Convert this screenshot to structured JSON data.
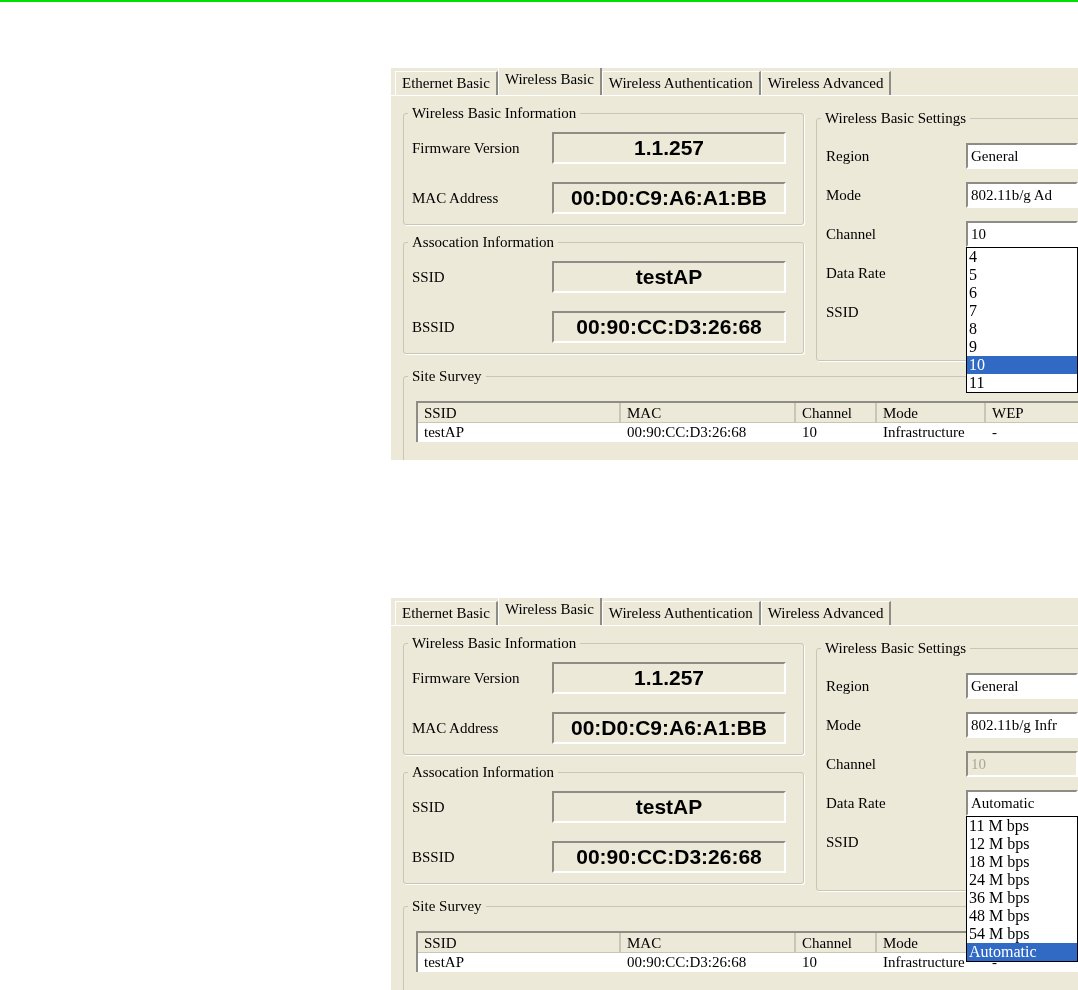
{
  "screenshots": [
    {
      "tabs": [
        {
          "label": "Ethernet Basic",
          "selected": false
        },
        {
          "label": "Wireless Basic",
          "selected": true
        },
        {
          "label": "Wireless Authentication",
          "selected": false
        },
        {
          "label": "Wireless Advanced",
          "selected": false
        }
      ],
      "info_group": {
        "title": "Wireless Basic Information",
        "rows": [
          {
            "label": "Firmware Version",
            "value": "1.1.257"
          },
          {
            "label": "MAC Address",
            "value": "00:D0:C9:A6:A1:BB"
          }
        ]
      },
      "association_group": {
        "title": "Assocation Information",
        "rows": [
          {
            "label": "SSID",
            "value": "testAP"
          },
          {
            "label": "BSSID",
            "value": "00:90:CC:D3:26:68"
          }
        ]
      },
      "settings_group": {
        "title": "Wireless Basic Settings",
        "fields": [
          {
            "label": "Region",
            "value": "General",
            "disabled": false
          },
          {
            "label": "Mode",
            "value": "802.11b/g Ad",
            "disabled": false
          },
          {
            "label": "Channel",
            "value": "10",
            "disabled": false,
            "options": [
              {
                "label": "4",
                "selected": false
              },
              {
                "label": "5",
                "selected": false
              },
              {
                "label": "6",
                "selected": false
              },
              {
                "label": "7",
                "selected": false
              },
              {
                "label": "8",
                "selected": false
              },
              {
                "label": "9",
                "selected": false
              },
              {
                "label": "10",
                "selected": true
              },
              {
                "label": "11",
                "selected": false
              }
            ]
          },
          {
            "label": "Data Rate"
          },
          {
            "label": "SSID"
          }
        ]
      },
      "site_survey": {
        "title": "Site Survey",
        "columns": [
          "SSID",
          "MAC",
          "Channel",
          "Mode",
          "WEP"
        ],
        "rows": [
          [
            "testAP",
            "00:90:CC:D3:26:68",
            "10",
            "Infrastructure",
            "-"
          ]
        ]
      }
    },
    {
      "tabs": [
        {
          "label": "Ethernet Basic",
          "selected": false
        },
        {
          "label": "Wireless Basic",
          "selected": true
        },
        {
          "label": "Wireless Authentication",
          "selected": false
        },
        {
          "label": "Wireless Advanced",
          "selected": false
        }
      ],
      "info_group": {
        "title": "Wireless Basic Information",
        "rows": [
          {
            "label": "Firmware Version",
            "value": "1.1.257"
          },
          {
            "label": "MAC Address",
            "value": "00:D0:C9:A6:A1:BB"
          }
        ]
      },
      "association_group": {
        "title": "Assocation Information",
        "rows": [
          {
            "label": "SSID",
            "value": "testAP"
          },
          {
            "label": "BSSID",
            "value": "00:90:CC:D3:26:68"
          }
        ]
      },
      "settings_group": {
        "title": "Wireless Basic Settings",
        "fields": [
          {
            "label": "Region",
            "value": "General",
            "disabled": false
          },
          {
            "label": "Mode",
            "value": "802.11b/g Infr",
            "disabled": false
          },
          {
            "label": "Channel",
            "value": "10",
            "disabled": true
          },
          {
            "label": "Data Rate",
            "value": "Automatic",
            "disabled": false,
            "options": [
              {
                "label": "11 M bps",
                "selected": false
              },
              {
                "label": "12 M bps",
                "selected": false
              },
              {
                "label": "18 M bps",
                "selected": false
              },
              {
                "label": "24 M bps",
                "selected": false
              },
              {
                "label": "36 M bps",
                "selected": false
              },
              {
                "label": "48 M bps",
                "selected": false
              },
              {
                "label": "54 M bps",
                "selected": false
              },
              {
                "label": "Automatic",
                "selected": true
              }
            ]
          },
          {
            "label": "SSID"
          }
        ]
      },
      "site_survey": {
        "title": "Site Survey",
        "columns": [
          "SSID",
          "MAC",
          "Channel",
          "Mode"
        ],
        "rows": [
          [
            "testAP",
            "00:90:CC:D3:26:68",
            "10",
            "Infrastructure",
            "-"
          ]
        ]
      }
    }
  ]
}
